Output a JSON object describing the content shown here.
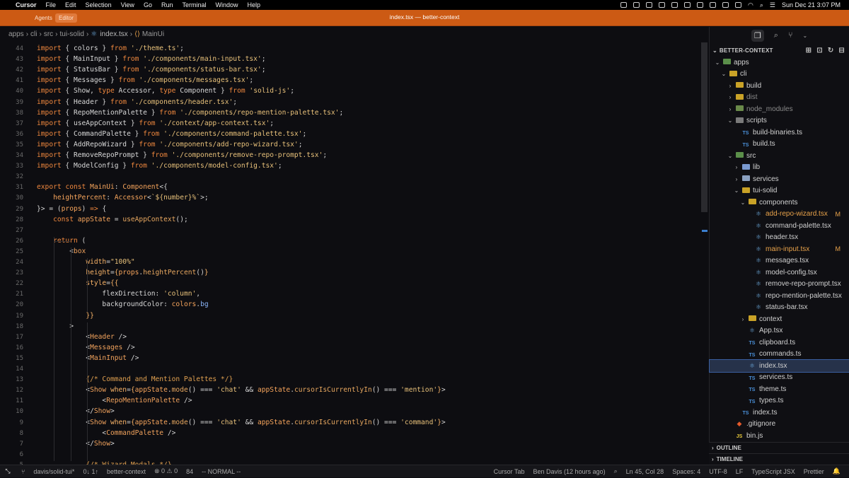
{
  "menubar": {
    "app": "Cursor",
    "items": [
      "File",
      "Edit",
      "Selection",
      "View",
      "Go",
      "Run",
      "Terminal",
      "Window",
      "Help"
    ],
    "datetime": "Sun Dec 21  3:07 PM"
  },
  "titlebar": {
    "agents": "Agents",
    "editor": "Editor",
    "title": "index.tsx — better-context"
  },
  "breadcrumb": [
    "apps",
    "cli",
    "src",
    "tui-solid",
    "index.tsx",
    "MainUi"
  ],
  "code_lines": [
    {
      "n": "44",
      "html": "<span class='kw'>import</span> { <span class='id'>colors</span> } <span class='kw'>from</span> <span class='str'>'./theme.ts'</span>;"
    },
    {
      "n": "43",
      "html": "<span class='kw'>import</span> { <span class='id'>MainInput</span> } <span class='kw'>from</span> <span class='str'>'./components/main-input.tsx'</span>;"
    },
    {
      "n": "42",
      "html": "<span class='kw'>import</span> { <span class='id'>StatusBar</span> } <span class='kw'>from</span> <span class='str'>'./components/status-bar.tsx'</span>;"
    },
    {
      "n": "41",
      "html": "<span class='kw'>import</span> { <span class='id'>Messages</span> } <span class='kw'>from</span> <span class='str'>'./components/messages.tsx'</span>;"
    },
    {
      "n": "40",
      "html": "<span class='kw'>import</span> { <span class='id'>Show</span>, <span class='kw'>type</span> <span class='id'>Accessor</span>, <span class='kw'>type</span> <span class='id'>Component</span> } <span class='kw'>from</span> <span class='str'>'solid-js'</span>;"
    },
    {
      "n": "39",
      "html": "<span class='kw'>import</span> { <span class='id'>Header</span> } <span class='kw'>from</span> <span class='str'>'./components/header.tsx'</span>;"
    },
    {
      "n": "38",
      "html": "<span class='kw'>import</span> { <span class='id'>RepoMentionPalette</span> } <span class='kw'>from</span> <span class='str'>'./components/repo-mention-palette.tsx'</span>;"
    },
    {
      "n": "37",
      "html": "<span class='kw'>import</span> { <span class='id'>useAppContext</span> } <span class='kw'>from</span> <span class='str'>'./context/app-context.tsx'</span>;"
    },
    {
      "n": "36",
      "html": "<span class='kw'>import</span> { <span class='id'>CommandPalette</span> } <span class='kw'>from</span> <span class='str'>'./components/command-palette.tsx'</span>;"
    },
    {
      "n": "35",
      "html": "<span class='kw'>import</span> { <span class='id'>AddRepoWizard</span> } <span class='kw'>from</span> <span class='str'>'./components/add-repo-wizard.tsx'</span>;"
    },
    {
      "n": "34",
      "html": "<span class='kw'>import</span> { <span class='id'>RemoveRepoPrompt</span> } <span class='kw'>from</span> <span class='str'>'./components/remove-repo-prompt.tsx'</span>;"
    },
    {
      "n": "33",
      "html": "<span class='kw'>import</span> { <span class='id'>ModelConfig</span> } <span class='kw'>from</span> <span class='str'>'./components/model-config.tsx'</span>;"
    },
    {
      "n": "32",
      "html": ""
    },
    {
      "n": "31",
      "html": "<span class='kw'>export</span> <span class='kw'>const</span> <span class='ty'>MainUi</span>: <span class='ty'>Component</span>&lt;{"
    },
    {
      "n": "30",
      "html": "    <span class='ty'>heightPercent</span>: <span class='ty'>Accessor</span>&lt;<span class='str'>`${number}%`</span>&gt;;"
    },
    {
      "n": "29",
      "html": "}&gt; = (<span class='ty'>props</span>) <span class='kw'>=&gt;</span> {"
    },
    {
      "n": "28",
      "html": "    <span class='kw'>const</span> <span class='ty'>appState</span> = <span class='fn'>useAppContext</span>();"
    },
    {
      "n": "27",
      "html": ""
    },
    {
      "n": "26",
      "html": "    <span class='kw'>return</span> ("
    },
    {
      "n": "25",
      "html": "        &lt;<span class='tag'>box</span>"
    },
    {
      "n": "24",
      "html": "            <span class='at'>width</span>=<span class='str'>\"100%\"</span>"
    },
    {
      "n": "23",
      "html": "            <span class='at'>height</span>=<span class='at'>{</span><span class='ty'>props</span>.<span class='fn'>heightPercent</span>()<span class='at'>}</span>"
    },
    {
      "n": "22",
      "html": "            <span class='at'>style</span>=<span class='at'>{{</span>"
    },
    {
      "n": "21",
      "html": "                <span class='id'>flexDirection</span>: <span class='str'>'column'</span>,"
    },
    {
      "n": "20",
      "html": "                <span class='id'>backgroundColor</span>: <span class='ty'>colors</span>.<span class='pp'>bg</span>"
    },
    {
      "n": "19",
      "html": "            <span class='at'>}}</span>"
    },
    {
      "n": "18",
      "html": "        &gt;"
    },
    {
      "n": "17",
      "html": "            &lt;<span class='tag'>Header</span> /&gt;"
    },
    {
      "n": "16",
      "html": "            &lt;<span class='tag'>Messages</span> /&gt;"
    },
    {
      "n": "15",
      "html": "            &lt;<span class='tag'>MainInput</span> /&gt;"
    },
    {
      "n": "14",
      "html": ""
    },
    {
      "n": "13",
      "html": "            <span class='cm'>{/* Command and Mention Palettes */}</span>"
    },
    {
      "n": "12",
      "html": "            &lt;<span class='tag'>Show</span> <span class='at'>when</span>=<span class='at'>{</span><span class='ty'>appState</span>.<span class='fn'>mode</span>() === <span class='str'>'chat'</span> &amp;&amp; <span class='ty'>appState</span>.<span class='fn'>cursorIsCurrentlyIn</span>() === <span class='str'>'mention'</span><span class='at'>}</span>&gt;"
    },
    {
      "n": "11",
      "html": "                &lt;<span class='tag'>RepoMentionPalette</span> /&gt;"
    },
    {
      "n": "10",
      "html": "            &lt;/<span class='tag'>Show</span>&gt;"
    },
    {
      "n": "9",
      "html": "            &lt;<span class='tag'>Show</span> <span class='at'>when</span>=<span class='at'>{</span><span class='ty'>appState</span>.<span class='fn'>mode</span>() === <span class='str'>'chat'</span> &amp;&amp; <span class='ty'>appState</span>.<span class='fn'>cursorIsCurrentlyIn</span>() === <span class='str'>'command'</span><span class='at'>}</span>&gt;"
    },
    {
      "n": "8",
      "html": "                &lt;<span class='tag'>CommandPalette</span> /&gt;"
    },
    {
      "n": "7",
      "html": "            &lt;/<span class='tag'>Show</span>&gt;"
    },
    {
      "n": "6",
      "html": ""
    },
    {
      "n": "5",
      "html": "            <span class='cm'>{/* Wizard Modals */}</span>"
    }
  ],
  "explorer": {
    "title": "BETTER-CONTEXT",
    "outline": "OUTLINE",
    "timeline": "TIMELINE",
    "rows": [
      {
        "d": 0,
        "c": "v",
        "t": "folder",
        "col": "#5b8f4a",
        "label": "apps",
        "cls": ""
      },
      {
        "d": 1,
        "c": "v",
        "t": "folder",
        "col": "#c9a227",
        "label": "cli",
        "cls": ""
      },
      {
        "d": 2,
        "c": ">",
        "t": "folder",
        "col": "#c9a227",
        "label": "build",
        "cls": ""
      },
      {
        "d": 2,
        "c": ">",
        "t": "folder",
        "col": "#c9a227",
        "label": "dist",
        "cls": "dim"
      },
      {
        "d": 2,
        "c": ">",
        "t": "folder",
        "col": "#6a8a4a",
        "label": "node_modules",
        "cls": "dim"
      },
      {
        "d": 2,
        "c": "v",
        "t": "folder",
        "col": "#7a7a7a",
        "label": "scripts",
        "cls": ""
      },
      {
        "d": 3,
        "c": "",
        "t": "ts",
        "label": "build-binaries.ts",
        "cls": ""
      },
      {
        "d": 3,
        "c": "",
        "t": "ts",
        "label": "build.ts",
        "cls": ""
      },
      {
        "d": 2,
        "c": "v",
        "t": "folder",
        "col": "#5b8f4a",
        "label": "src",
        "cls": ""
      },
      {
        "d": 3,
        "c": ">",
        "t": "folder",
        "col": "#7a9ad0",
        "label": "lib",
        "cls": ""
      },
      {
        "d": 3,
        "c": ">",
        "t": "folder",
        "col": "#8aa0c0",
        "label": "services",
        "cls": ""
      },
      {
        "d": 3,
        "c": "v",
        "t": "folder",
        "col": "#c9a227",
        "label": "tui-solid",
        "cls": ""
      },
      {
        "d": 4,
        "c": "v",
        "t": "folder",
        "col": "#c9a227",
        "label": "components",
        "cls": ""
      },
      {
        "d": 5,
        "c": "",
        "t": "react",
        "label": "add-repo-wizard.tsx",
        "cls": "m",
        "flag": "M"
      },
      {
        "d": 5,
        "c": "",
        "t": "react",
        "label": "command-palette.tsx",
        "cls": ""
      },
      {
        "d": 5,
        "c": "",
        "t": "react",
        "label": "header.tsx",
        "cls": ""
      },
      {
        "d": 5,
        "c": "",
        "t": "react",
        "label": "main-input.tsx",
        "cls": "m",
        "flag": "M"
      },
      {
        "d": 5,
        "c": "",
        "t": "react",
        "label": "messages.tsx",
        "cls": ""
      },
      {
        "d": 5,
        "c": "",
        "t": "react",
        "label": "model-config.tsx",
        "cls": ""
      },
      {
        "d": 5,
        "c": "",
        "t": "react",
        "label": "remove-repo-prompt.tsx",
        "cls": ""
      },
      {
        "d": 5,
        "c": "",
        "t": "react",
        "label": "repo-mention-palette.tsx",
        "cls": ""
      },
      {
        "d": 5,
        "c": "",
        "t": "react",
        "label": "status-bar.tsx",
        "cls": ""
      },
      {
        "d": 4,
        "c": ">",
        "t": "folder",
        "col": "#c9a227",
        "label": "context",
        "cls": ""
      },
      {
        "d": 4,
        "c": "",
        "t": "react",
        "label": "App.tsx",
        "cls": ""
      },
      {
        "d": 4,
        "c": "",
        "t": "ts",
        "label": "clipboard.ts",
        "cls": ""
      },
      {
        "d": 4,
        "c": "",
        "t": "ts",
        "label": "commands.ts",
        "cls": ""
      },
      {
        "d": 4,
        "c": "",
        "t": "react",
        "label": "index.tsx",
        "cls": "sel"
      },
      {
        "d": 4,
        "c": "",
        "t": "ts",
        "label": "services.ts",
        "cls": ""
      },
      {
        "d": 4,
        "c": "",
        "t": "ts",
        "label": "theme.ts",
        "cls": ""
      },
      {
        "d": 4,
        "c": "",
        "t": "ts",
        "label": "types.ts",
        "cls": ""
      },
      {
        "d": 3,
        "c": "",
        "t": "ts",
        "label": "index.ts",
        "cls": ""
      },
      {
        "d": 2,
        "c": "",
        "t": "git",
        "label": ".gitignore",
        "cls": ""
      },
      {
        "d": 2,
        "c": "",
        "t": "js",
        "label": "bin.js",
        "cls": ""
      }
    ]
  },
  "statusbar": {
    "branch": "davis/solid-tui*",
    "sync": "0↓ 1↑",
    "project": "better-context",
    "problems": "⊗ 0 ⚠ 0",
    "ports": "84",
    "mode": "-- NORMAL --",
    "cursor_tab": "Cursor Tab",
    "blame": "Ben Davis (12 hours ago)",
    "position": "Ln 45, Col 28",
    "spaces": "Spaces: 4",
    "encoding": "UTF-8",
    "eol": "LF",
    "language": "TypeScript JSX",
    "formatter": "Prettier"
  }
}
